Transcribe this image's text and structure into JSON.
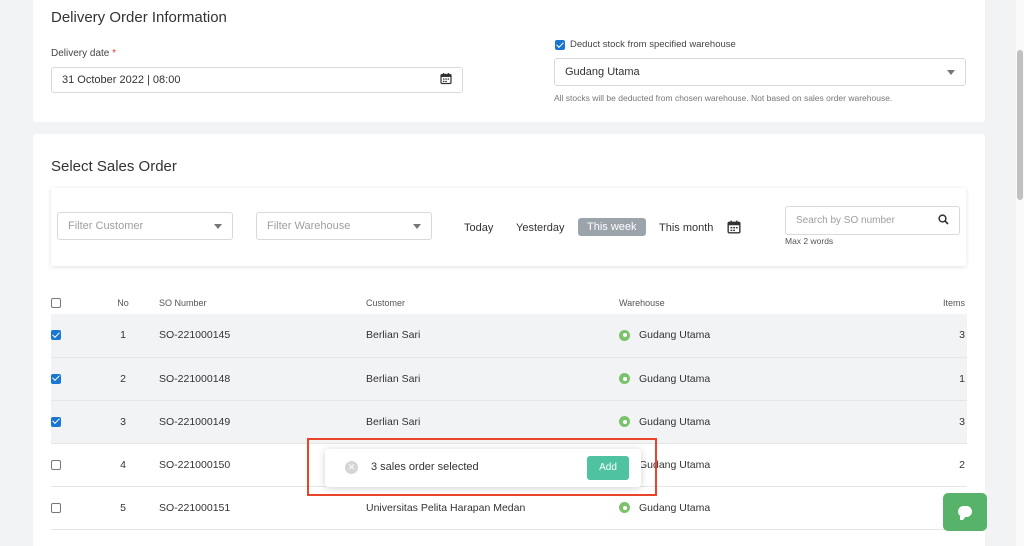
{
  "delivery_info": {
    "title": "Delivery Order Information",
    "date_label": "Delivery date",
    "required_mark": "*",
    "date_value": "31 October 2022 | 08:00",
    "deduct_label": "Deduct stock from specified warehouse",
    "deduct_checked": true,
    "warehouse_value": "Gudang Utama",
    "warehouse_helper": "All stocks will be deducted from chosen warehouse. Not based on sales order warehouse."
  },
  "sales_order": {
    "title": "Select Sales Order",
    "filter_customer_placeholder": "Filter Customer",
    "filter_warehouse_placeholder": "Filter Warehouse",
    "date_filters": {
      "today": "Today",
      "yesterday": "Yesterday",
      "this_week": "This week",
      "this_month": "This month",
      "active": "this_week"
    },
    "search_placeholder": "Search by SO number",
    "search_helper": "Max 2 words",
    "columns": {
      "no": "No",
      "so_number": "SO Number",
      "customer": "Customer",
      "warehouse": "Warehouse",
      "items": "Items"
    },
    "rows": [
      {
        "checked": true,
        "no": "1",
        "so": "SO-221000145",
        "customer": "Berlian Sari",
        "warehouse": "Gudang Utama",
        "items": "3"
      },
      {
        "checked": true,
        "no": "2",
        "so": "SO-221000148",
        "customer": "Berlian Sari",
        "warehouse": "Gudang Utama",
        "items": "1"
      },
      {
        "checked": true,
        "no": "3",
        "so": "SO-221000149",
        "customer": "Berlian Sari",
        "warehouse": "Gudang Utama",
        "items": "3"
      },
      {
        "checked": false,
        "no": "4",
        "so": "SO-221000150",
        "customer": "",
        "warehouse": "Gudang Utama",
        "items": "2"
      },
      {
        "checked": false,
        "no": "5",
        "so": "SO-221000151",
        "customer": "Universitas Pelita Harapan Medan",
        "warehouse": "Gudang Utama",
        "items": ""
      }
    ]
  },
  "toast": {
    "close_glyph": "✕",
    "text": "3 sales order selected",
    "add_label": "Add"
  },
  "colors": {
    "accent_blue": "#1976d2",
    "add_button": "#4fc3a1",
    "chat_button": "#57b36a",
    "highlight_border": "#e8442a",
    "pin": "#7cc26a"
  }
}
